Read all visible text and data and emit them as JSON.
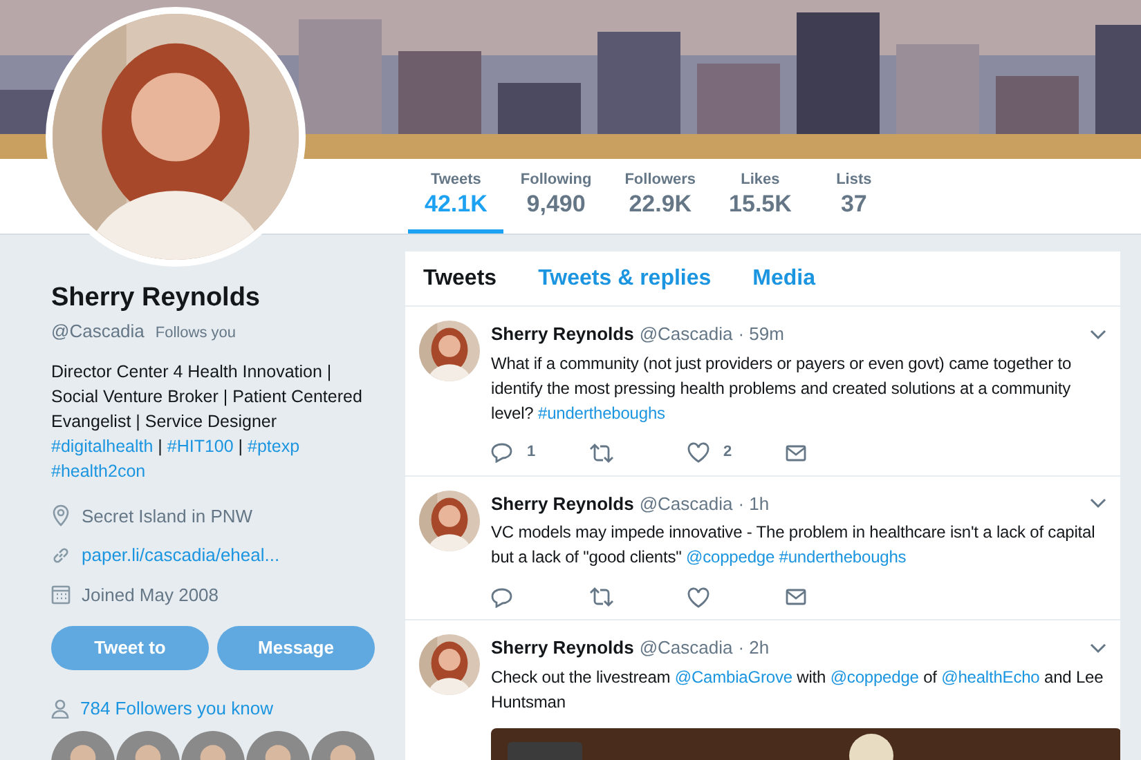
{
  "banner": {
    "kind": "picture"
  },
  "profile": {
    "name": "Sherry Reynolds",
    "handle": "@Cascadia",
    "follows_you": "Follows you",
    "bio": [
      {
        "kind": "text",
        "text": "Director Center 4 Health Innovation | Social Venture Broker | Patient Centered Evangelist | Service Designer "
      },
      {
        "kind": "link",
        "text": "#digitalhealth"
      },
      {
        "kind": "text",
        "text": " | "
      },
      {
        "kind": "link",
        "text": "#HIT100"
      },
      {
        "kind": "text",
        "text": " | "
      },
      {
        "kind": "link",
        "text": "#ptexp"
      },
      {
        "kind": "link",
        "text": "#health2con"
      }
    ],
    "location": "Secret Island in PNW",
    "website": "paper.li/cascadia/eheal...",
    "joined": "Joined May 2008",
    "buttons": [
      "Tweet to",
      "Message"
    ],
    "followers_you_know": "784 Followers you know",
    "known_followers": [
      {
        "kind": "picture"
      },
      {
        "kind": "picture"
      },
      {
        "kind": "picture"
      },
      {
        "kind": "picture"
      },
      {
        "kind": "picture"
      }
    ]
  },
  "stats": [
    {
      "label": "Tweets",
      "value": "42.1K",
      "selected": true
    },
    {
      "label": "Following",
      "value": "9,490",
      "selected": false
    },
    {
      "label": "Followers",
      "value": "22.9K",
      "selected": false
    },
    {
      "label": "Likes",
      "value": "15.5K",
      "selected": false
    },
    {
      "label": "Lists",
      "value": "37",
      "selected": false
    }
  ],
  "tabs": [
    {
      "label": "Tweets",
      "selected": true
    },
    {
      "label": "Tweets & replies",
      "selected": false
    },
    {
      "label": "Media",
      "selected": false
    }
  ],
  "tweets": [
    {
      "name": "Sherry Reynolds",
      "handle": "@Cascadia",
      "time": "· 59m",
      "body": [
        {
          "kind": "text",
          "text": "What if a community (not just providers or payers or even govt) came together to identify the most pressing health problems and created solutions at a community level? "
        },
        {
          "kind": "link",
          "text": "#undertheboughs"
        }
      ],
      "replies": "1",
      "likes": "2"
    },
    {
      "name": "Sherry Reynolds",
      "handle": "@Cascadia",
      "time": "· 1h",
      "body": [
        {
          "kind": "text",
          "text": "VC models may impede innovative - The problem in healthcare isn't a lack of capital  but a lack of \"good clients\" "
        },
        {
          "kind": "link",
          "text": "@coppedge"
        },
        {
          "kind": "link",
          "text": "#undertheboughs"
        }
      ]
    },
    {
      "name": "Sherry Reynolds",
      "handle": "@Cascadia",
      "time": "· 2h",
      "body": [
        {
          "kind": "text",
          "text": "Check out the livestream "
        },
        {
          "kind": "link",
          "text": "@CambiaGrove"
        },
        {
          "kind": "text",
          "text": " with "
        },
        {
          "kind": "link",
          "text": "@coppedge"
        },
        {
          "kind": "text",
          "text": " of "
        },
        {
          "kind": "link",
          "text": "@healthEcho"
        },
        {
          "kind": "text",
          "text": " and Lee Huntsman"
        }
      ],
      "media": {
        "kind": "picture"
      }
    }
  ]
}
